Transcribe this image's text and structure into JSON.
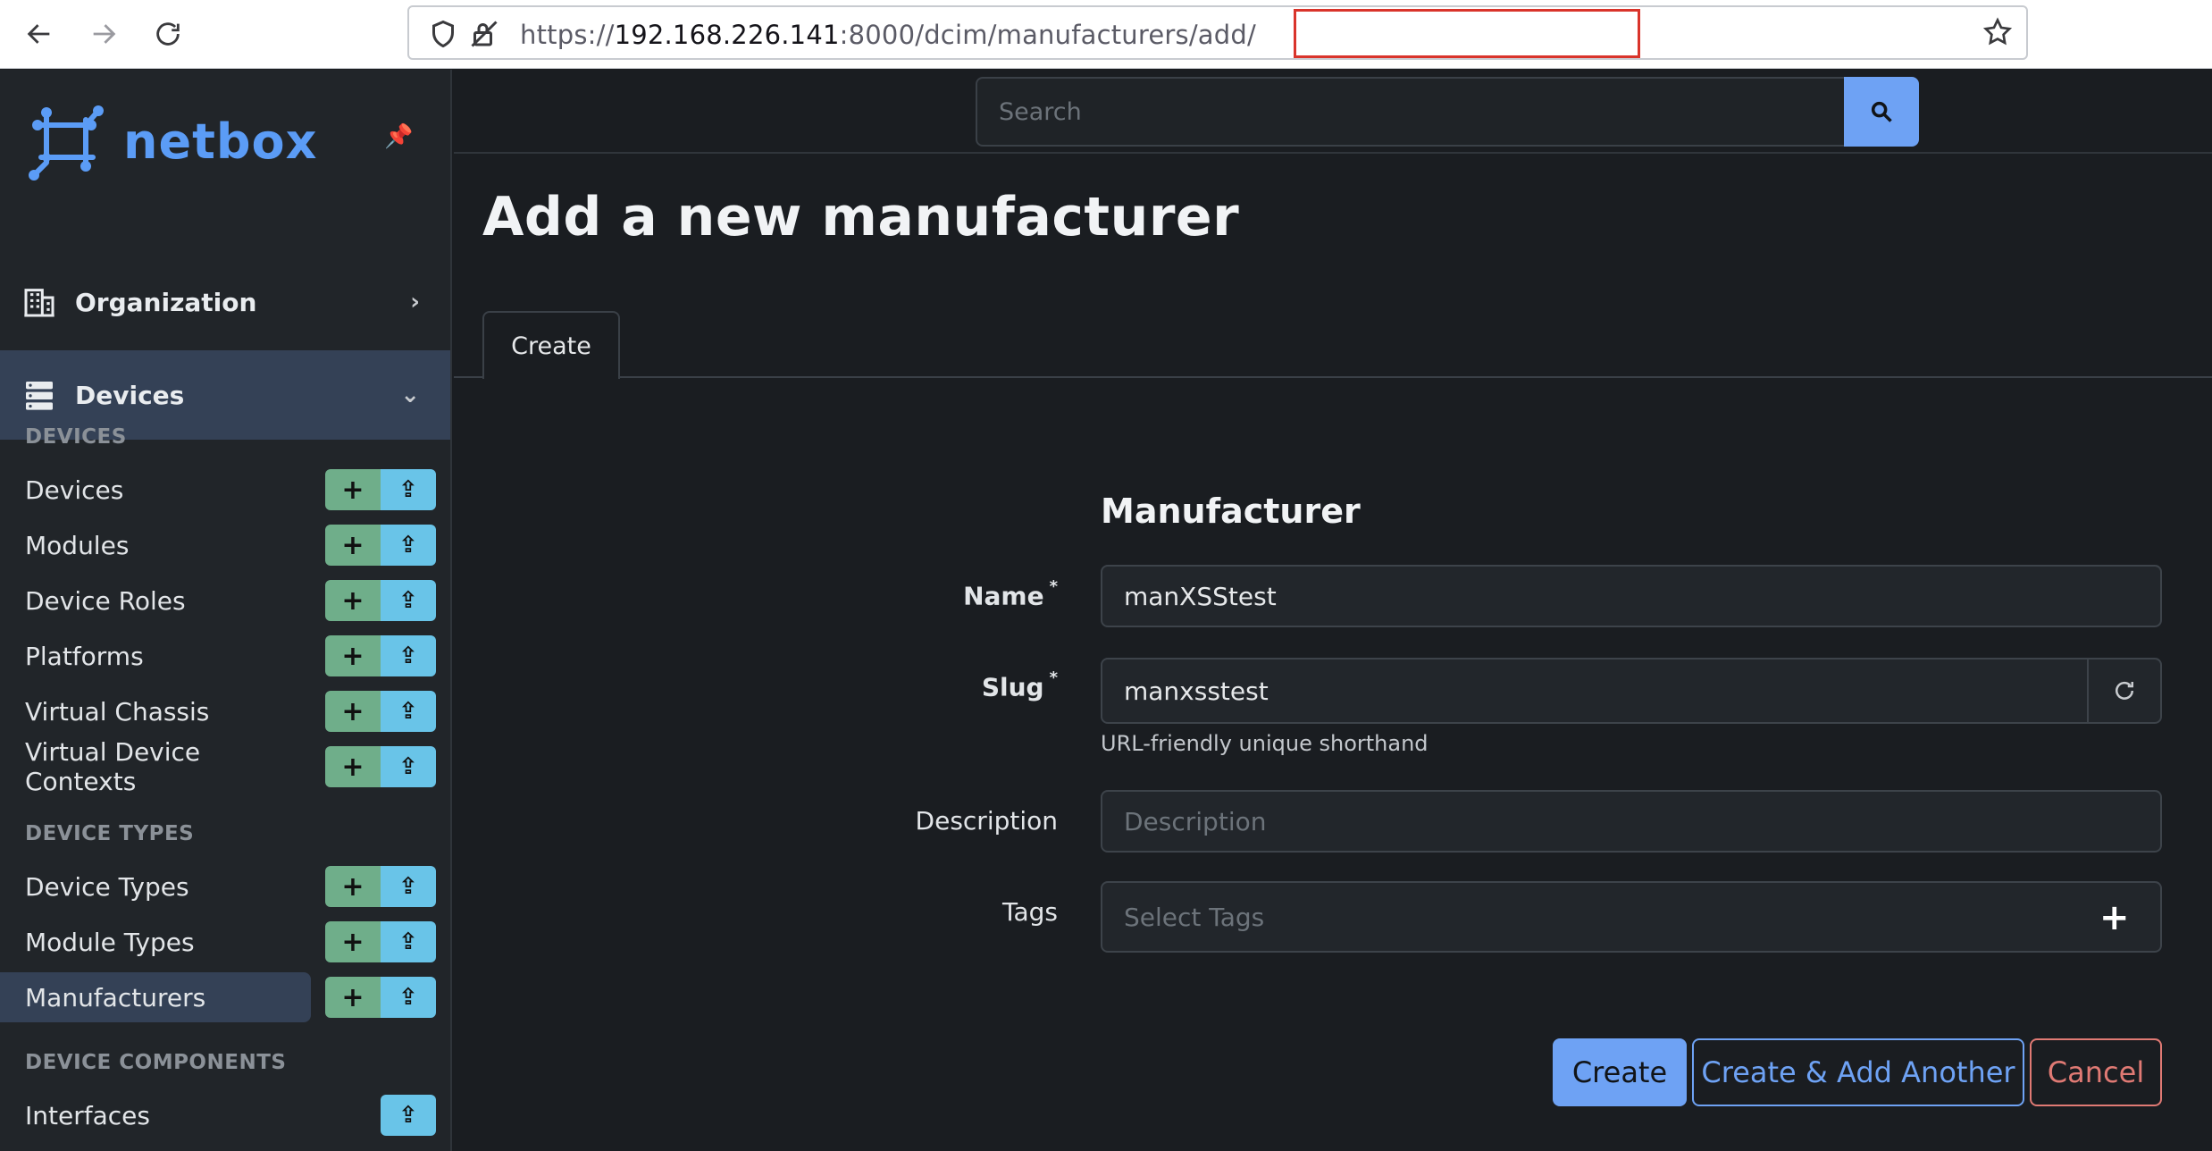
{
  "browser": {
    "url_prefix": "https://",
    "url_host": "192.168.226.141",
    "url_port": ":8000",
    "url_path": "/dcim/manufacturers/add/"
  },
  "brand": {
    "name": "netbox"
  },
  "search": {
    "placeholder": "Search"
  },
  "sidebar": {
    "menus": [
      {
        "label": "Organization",
        "chevron": "›",
        "icon": "building-icon"
      },
      {
        "label": "Devices",
        "chevron": "⌄",
        "icon": "server-icon"
      }
    ],
    "sections": [
      {
        "label": "DEVICES",
        "items": [
          "Devices",
          "Modules",
          "Device Roles",
          "Platforms",
          "Virtual Chassis",
          "Virtual Device Contexts"
        ]
      },
      {
        "label": "DEVICE TYPES",
        "items": [
          "Device Types",
          "Module Types",
          "Manufacturers"
        ]
      },
      {
        "label": "DEVICE COMPONENTS",
        "items": [
          "Interfaces"
        ]
      }
    ],
    "selected_item": "Manufacturers",
    "add_symbol": "+",
    "import_symbol": "⇪"
  },
  "page": {
    "title": "Add a new manufacturer",
    "tab_label": "Create"
  },
  "form": {
    "section_title": "Manufacturer",
    "name_label": "Name",
    "name_value": "manXSStest",
    "slug_label": "Slug",
    "slug_value": "manxsstest",
    "slug_help": "URL-friendly unique shorthand",
    "description_label": "Description",
    "description_placeholder": "Description",
    "tags_label": "Tags",
    "tags_placeholder": "Select Tags",
    "required_mark": "*",
    "tags_add_symbol": "+"
  },
  "actions": {
    "create": "Create",
    "create_another": "Create & Add Another",
    "cancel": "Cancel"
  },
  "colors": {
    "accent": "#6ea2f4",
    "add_green": "#6fae8a",
    "import_blue": "#69c4e8",
    "cancel_red": "#e07a74",
    "url_highlight": "#d9342b"
  }
}
